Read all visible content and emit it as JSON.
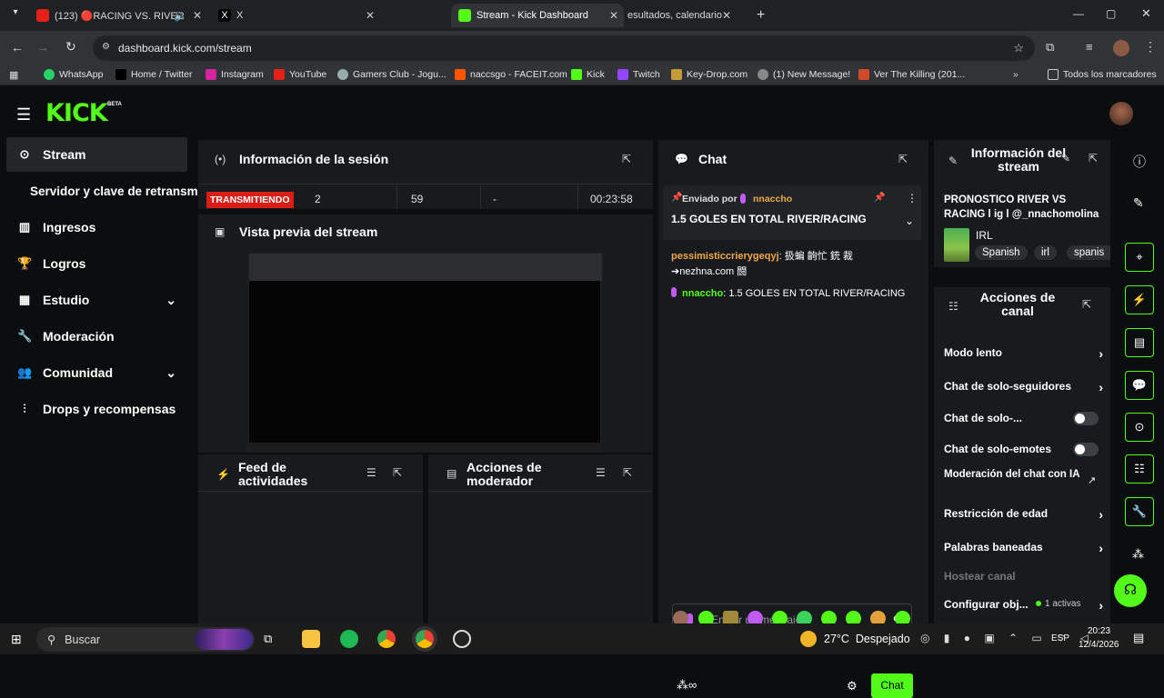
{
  "browser": {
    "tabs": [
      {
        "label": "(123) 🔴RACING VS. RIVER",
        "icon": "youtube-icon"
      },
      {
        "label": "X",
        "icon": "x-icon"
      },
      {
        "label": "Stream - Kick Dashboard",
        "icon": "kick-icon"
      },
      {
        "label": "esultados, calendario",
        "icon": "page-icon"
      }
    ],
    "url": "dashboard.kick.com/stream",
    "bookmarks": [
      "WhatsApp",
      "Home / Twitter",
      "Instagram",
      "YouTube",
      "Gamers Club - Jogu...",
      "naccsgo - FACEIT.com",
      "Kick",
      "Twitch",
      "Key-Drop.com",
      "(1) New Message!",
      "Ver The Killing (201...",
      "Todos los marcadores"
    ]
  },
  "brand": {
    "logo": "KICK",
    "beta": "BETA",
    "accent": "#53fc18"
  },
  "sidebar": {
    "items": [
      {
        "label": "Stream",
        "icon": "broadcast-icon"
      },
      {
        "label": "Servidor y clave de retransmisión"
      },
      {
        "label": "Ingresos",
        "icon": "chart-icon"
      },
      {
        "label": "Logros",
        "icon": "trophy-icon"
      },
      {
        "label": "Estudio",
        "icon": "grid-icon"
      },
      {
        "label": "Moderación",
        "icon": "wrench-icon"
      },
      {
        "label": "Comunidad",
        "icon": "people-icon"
      },
      {
        "label": "Drops y recompensas",
        "icon": "bars-icon"
      }
    ]
  },
  "session": {
    "title": "Información de la sesión",
    "status": "TRANSMITIENDO",
    "viewers": "2",
    "followers": "59",
    "dash": "-",
    "duration": "00:23:58"
  },
  "preview": {
    "title": "Vista previa del stream"
  },
  "activity": {
    "title": "Feed de actividades"
  },
  "modactions": {
    "title": "Acciones de moderador"
  },
  "chat": {
    "title": "Chat",
    "pinned_by_label": "Enviado por",
    "pinned_user": "nnaccho",
    "pinned_text": "1.5 GOLES EN TOTAL RIVER/RACING",
    "messages": [
      {
        "user": "pessimisticcrierygeqyj",
        "text": "扱蝙 齣忙 銃 裁 ➔nezhna.com 闘",
        "color": "#f0a94a"
      },
      {
        "user": "nnaccho",
        "text": "1.5 GOLES EN TOTAL RIVER/RACING",
        "color": "#53fc18"
      }
    ],
    "placeholder": "Enviar un mensaje",
    "send_label": "Chat"
  },
  "stream_info": {
    "title": "Información del stream",
    "stream_title": "PRONOSTICO RIVER VS RACING l ig l @_nnachomolina",
    "category": "IRL",
    "tags": [
      "Spanish",
      "irl",
      "spanis"
    ]
  },
  "channel_actions": {
    "title": "Acciones de canal",
    "items": [
      "Modo lento",
      "Chat de solo-seguidores",
      "Chat de solo-...",
      "Chat de solo-emotes",
      "Moderación del chat con IA",
      "Restricción de edad",
      "Palabras baneadas",
      "Hostear canal",
      "Configurar obj..."
    ],
    "active_count": "1 activas"
  },
  "taskbar": {
    "search": "Buscar",
    "weather": "27°C  Despejado",
    "lang": "ESP",
    "time": "20:23",
    "date": "12/4/2026"
  }
}
